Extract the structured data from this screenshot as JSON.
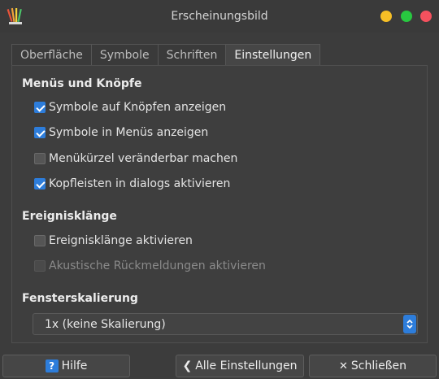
{
  "window": {
    "title": "Erscheinungsbild"
  },
  "tabs": [
    {
      "label": "Oberfläche",
      "mnemonic": "O",
      "active": false
    },
    {
      "label": "Symbole",
      "mnemonic": "S",
      "active": false
    },
    {
      "label": "Schriften",
      "mnemonic": "h",
      "active": false
    },
    {
      "label": "Einstellungen",
      "mnemonic": "E",
      "active": true
    }
  ],
  "sections": {
    "menus": {
      "title": "Menüs und Knöpfe",
      "options": [
        {
          "label": "Symbole auf Knöpfen anzeigen",
          "checked": true,
          "enabled": true
        },
        {
          "label": "Symbole in Menüs anzeigen",
          "checked": true,
          "enabled": true
        },
        {
          "label": "Menükürzel veränderbar machen",
          "checked": false,
          "enabled": true
        },
        {
          "label": "Kopfleisten in dialogs aktivieren",
          "checked": true,
          "enabled": true
        }
      ]
    },
    "sounds": {
      "title": "Ereignisklänge",
      "options": [
        {
          "label": "Ereignisklänge aktivieren",
          "checked": false,
          "enabled": true
        },
        {
          "label": "Akustische Rückmeldungen aktivieren",
          "checked": false,
          "enabled": false
        }
      ]
    },
    "scaling": {
      "title": "Fensterskalierung",
      "selected": "1x (keine Skalierung)"
    }
  },
  "buttons": {
    "help": "Hilfe",
    "all_settings": "Alle Einstellungen",
    "close": "Schließen"
  },
  "colors": {
    "accent": "#2d7ddb",
    "window_bg": "#3c3c3c",
    "traffic_minimize": "#f6bf26",
    "traffic_maximize": "#28c840",
    "traffic_close": "#f4515e"
  },
  "icons": {
    "app": "appearance-icon",
    "help": "help-icon",
    "back": "chevron-left-icon",
    "close": "close-x-icon",
    "select": "updown-arrows-icon"
  }
}
